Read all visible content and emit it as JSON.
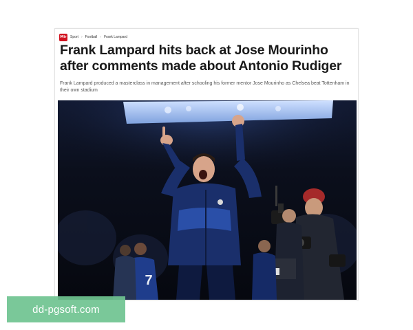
{
  "breadcrumb": {
    "logo_text": "Mir",
    "items": [
      "Sport",
      "Football",
      "Frank Lampard"
    ],
    "separator": "›"
  },
  "article": {
    "headline": "Frank Lampard hits back at Jose Mourinho after comments made about Antonio Rudiger",
    "standfirst": "Frank Lampard produced a masterclass in management after schooling his former mentor Jose Mourinho as Chelsea beat Tottenham in their own stadium"
  },
  "photo": {
    "jersey_number": "7",
    "colors": {
      "kit_navy": "#1a2f6b",
      "kit_blue": "#2a4fa8",
      "stadium_light": "#a9c3ee",
      "background": "#0b0f1c",
      "beanie_red": "#a52a2a"
    }
  },
  "watermark": {
    "text": "dd-pgsoft.com",
    "color": "#6fc491"
  }
}
